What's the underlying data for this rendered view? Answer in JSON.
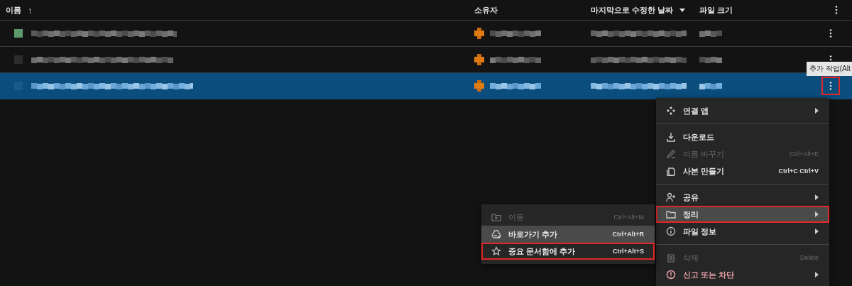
{
  "table": {
    "columns": [
      {
        "label": "이름",
        "sort_arrow": "↑"
      },
      {
        "label": "소유자"
      },
      {
        "label": "마지막으로 수정한 날짜",
        "dropdown": true
      },
      {
        "label": "파일 크기"
      }
    ],
    "rows": [
      {
        "selected": false,
        "color": "#5c9a6c",
        "more_outlined": false
      },
      {
        "selected": false,
        "color": "#2c2c2c",
        "more_outlined": false
      },
      {
        "selected": true,
        "color": "#1a5a88",
        "more_outlined": true
      }
    ]
  },
  "tooltip": {
    "text": "추가 작업(Alt"
  },
  "menu": {
    "items": [
      {
        "kind": "item",
        "label": "연결 앱",
        "submenu": true,
        "disabled": false,
        "hovered": false,
        "outlined": false,
        "danger": false
      },
      {
        "kind": "divider"
      },
      {
        "kind": "item",
        "label": "다운로드",
        "submenu": false,
        "disabled": false,
        "hovered": false,
        "outlined": false,
        "danger": false
      },
      {
        "kind": "item",
        "label": "이름 바꾸기",
        "shortcut": "Ctrl+Alt+E",
        "submenu": false,
        "disabled": true,
        "hovered": false,
        "outlined": false,
        "danger": false
      },
      {
        "kind": "item",
        "label": "사본 만들기",
        "shortcut": "Ctrl+C Ctrl+V",
        "submenu": false,
        "disabled": false,
        "hovered": false,
        "outlined": false,
        "danger": false
      },
      {
        "kind": "divider"
      },
      {
        "kind": "item",
        "label": "공유",
        "submenu": true,
        "disabled": false,
        "hovered": false,
        "outlined": false,
        "danger": false
      },
      {
        "kind": "item",
        "label": "정리",
        "submenu": true,
        "disabled": false,
        "hovered": true,
        "outlined": true,
        "danger": false
      },
      {
        "kind": "item",
        "label": "파일 정보",
        "submenu": true,
        "disabled": false,
        "hovered": false,
        "outlined": false,
        "danger": false
      },
      {
        "kind": "divider"
      },
      {
        "kind": "item",
        "label": "삭제",
        "shortcut": "Delete",
        "submenu": false,
        "disabled": true,
        "hovered": false,
        "outlined": false,
        "danger": false
      },
      {
        "kind": "item",
        "label": "신고 또는 차단",
        "submenu": true,
        "disabled": false,
        "hovered": false,
        "outlined": false,
        "danger": true
      }
    ]
  },
  "submenu": {
    "items": [
      {
        "kind": "item",
        "label": "이동",
        "shortcut": "Ctrl+Alt+M",
        "submenu": false,
        "disabled": true,
        "hovered": false,
        "outlined": false,
        "danger": false
      },
      {
        "kind": "item",
        "label": "바로가기 추가",
        "shortcut": "Ctrl+Alt+R",
        "submenu": false,
        "disabled": false,
        "hovered": true,
        "outlined": false,
        "danger": false
      },
      {
        "kind": "item",
        "label": "중요 문서함에 추가",
        "shortcut": "Ctrl+Alt+S",
        "submenu": false,
        "disabled": false,
        "hovered": false,
        "outlined": true,
        "danger": false
      }
    ]
  }
}
